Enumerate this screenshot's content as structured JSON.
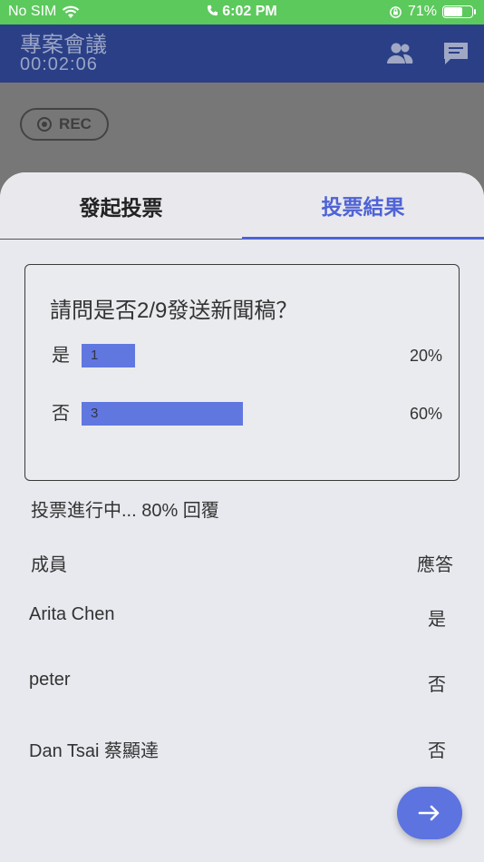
{
  "status_bar": {
    "carrier": "No SIM",
    "time": "6:02 PM",
    "battery_percent": "71%",
    "battery_level": 0.71,
    "icons": [
      "wifi-icon",
      "phone-icon",
      "orientation-lock-icon",
      "battery-charging-icon"
    ]
  },
  "header": {
    "title": "專案會議",
    "timer": "00:02:06",
    "icons": [
      "people-icon",
      "chat-icon"
    ]
  },
  "rec_button": {
    "label": "REC",
    "icon": "record-icon"
  },
  "tabs": [
    {
      "label": "發起投票",
      "active": false
    },
    {
      "label": "投票結果",
      "active": true
    }
  ],
  "poll": {
    "question": "請問是否2/9發送新聞稿？",
    "options": [
      {
        "label": "是",
        "count": "1",
        "percent_text": "20%",
        "fraction": 0.2
      },
      {
        "label": "否",
        "count": "3",
        "percent_text": "60%",
        "fraction": 0.6
      }
    ]
  },
  "progress_text": "投票進行中... 80% 回覆",
  "members": {
    "header_name": "成員",
    "header_answer": "應答",
    "rows": [
      {
        "name": "Arita Chen",
        "answer": "是"
      },
      {
        "name": "peter",
        "answer": "否"
      },
      {
        "name": "Dan Tsai 蔡顯達",
        "answer": "否"
      }
    ]
  },
  "fab": {
    "icon": "arrow-right-icon"
  },
  "colors": {
    "status_green": "#5cc95c",
    "header_blue": "#2a3f86",
    "accent": "#4f63d6",
    "bar": "#6177e0"
  }
}
